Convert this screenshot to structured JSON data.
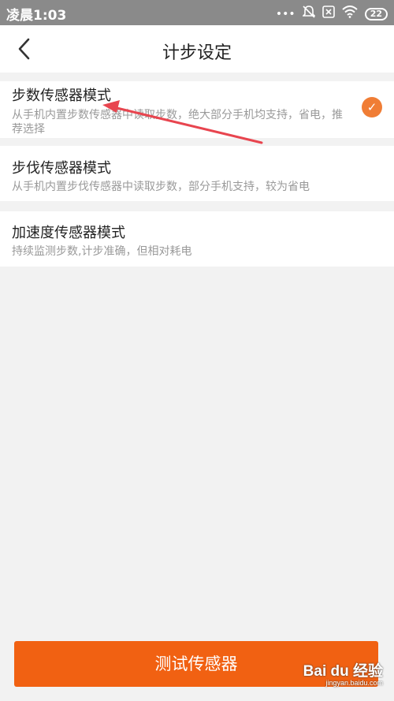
{
  "status_bar": {
    "time": "凌晨1:03",
    "icons": [
      "more-dots-icon",
      "silent-bell-icon",
      "no-sim-icon",
      "wifi-icon"
    ],
    "battery": "22"
  },
  "header": {
    "title": "计步设定",
    "back_icon": "chevron-left-icon"
  },
  "options": [
    {
      "title": "步数传感器模式",
      "description": "从手机内置步数传感器中读取步数，绝大部分手机均支持，省电，推荐选择",
      "selected": true
    },
    {
      "title": "步伐传感器模式",
      "description": "从手机内置步伐传感器中读取步数，部分手机支持，较为省电",
      "selected": false
    },
    {
      "title": "加速度传感器模式",
      "description": "持续监测步数,计步准确，但相对耗电",
      "selected": false
    }
  ],
  "test_button": {
    "label": "测试传感器"
  },
  "watermark": {
    "main": "Bai du 经验",
    "sub": "jingyan.baidu.com"
  },
  "colors": {
    "accent": "#f07d35",
    "button": "#f16112",
    "arrow": "#e8454f",
    "status_bar": "#8a8a8a"
  }
}
